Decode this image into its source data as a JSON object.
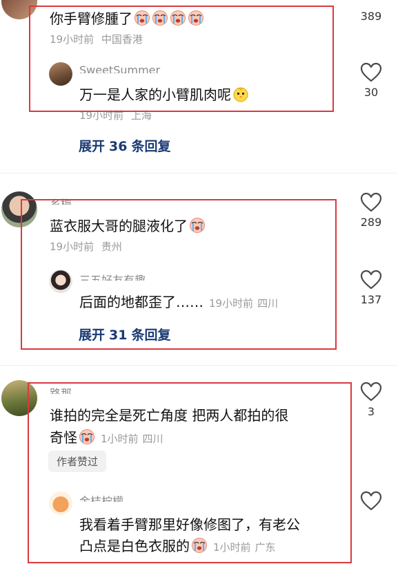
{
  "comments": [
    {
      "text": "你手臂修腫了",
      "time": "19小时前",
      "location": "中国香港",
      "likes": "389",
      "reply": {
        "username": "SweetSummer",
        "text": "万一是人家的小臂肌肉呢",
        "time": "19小时前",
        "location": "上海",
        "likes": "30"
      },
      "expand": {
        "prefix": "展开",
        "count": "36",
        "suffix": "条回复"
      }
    },
    {
      "username": "乡梅",
      "text": "蓝衣服大哥的腿液化了",
      "time": "19小时前",
      "location": "贵州",
      "likes": "289",
      "reply": {
        "username": "三五好友有趣",
        "text": "后面的地都歪了……",
        "time": "19小时前",
        "location": "四川",
        "likes": "137"
      },
      "expand": {
        "prefix": "展开",
        "count": "31",
        "suffix": "条回复"
      }
    },
    {
      "username": "路那",
      "text_line1": "谁拍的完全是死亡角度 把两人都拍的很",
      "text_line2": "奇怪",
      "time": "1小时前",
      "location": "四川",
      "likes": "3",
      "badge": "作者赞过",
      "reply": {
        "username": "金桔柠檬",
        "text_line1": "我看着手臂那里好像修图了，有老公",
        "text_line2": "凸点是白色衣服的",
        "time": "1小时前",
        "location": "广东"
      }
    }
  ],
  "colors": {
    "highlight_box": "#d9393f",
    "expand_link": "#1a3a73",
    "meta_gray": "#9a9a9a"
  },
  "icons": {
    "like": "heart-outline-icon",
    "emoji": "crying-face-emoji",
    "emoji_alt": "chick-face-emoji"
  }
}
